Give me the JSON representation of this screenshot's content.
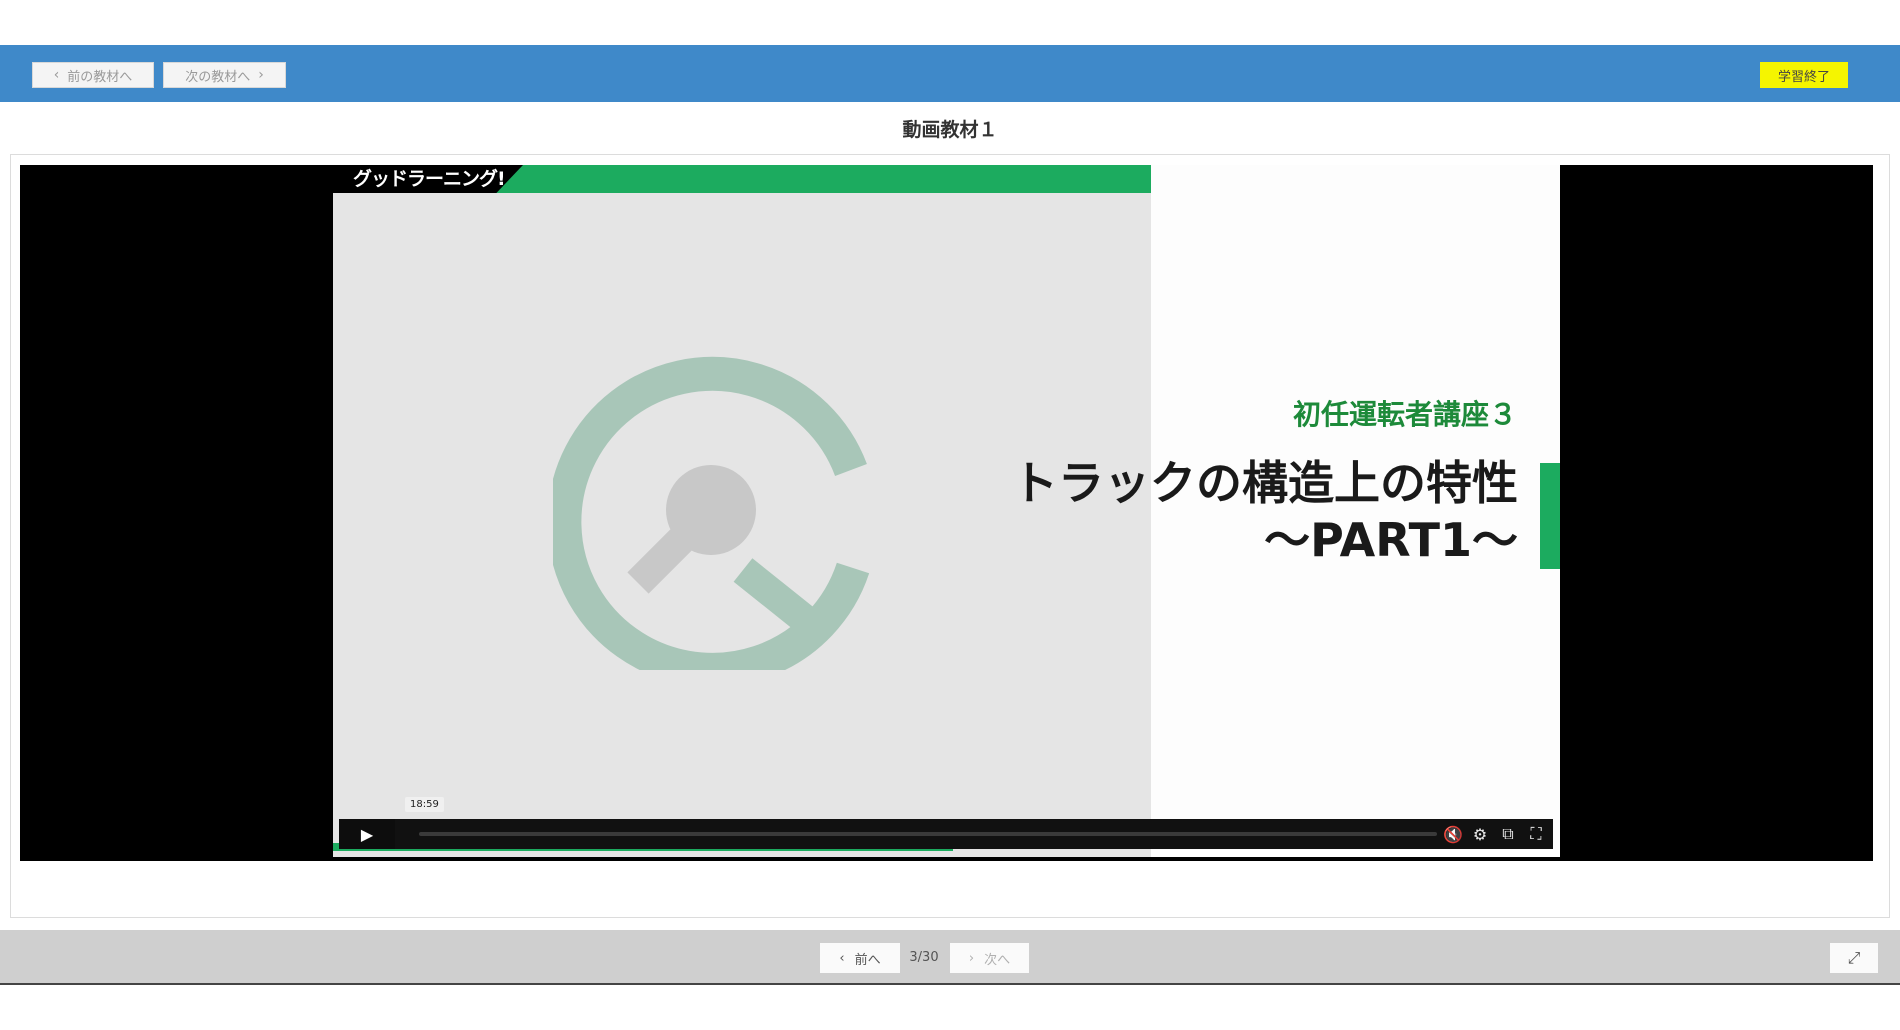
{
  "header": {
    "prev_material_label": "前の教材へ",
    "next_material_label": "次の教材へ",
    "finish_label": "学習終了"
  },
  "material_title": "動画教材１",
  "video": {
    "brand_name": "グッドラーニング!",
    "course_label": "初任運転者講座３",
    "title_line1": "トラックの構造上の特性",
    "title_line2": "～PART1～",
    "time_tooltip": "18:59",
    "progress_fraction": 0.0
  },
  "player_icons": [
    "volume-muted-icon",
    "settings-gear-icon",
    "picture-in-picture-icon",
    "fullscreen-icon"
  ],
  "pager": {
    "prev_label": "前へ",
    "next_label": "次へ",
    "page_counter": "3/30"
  },
  "colors": {
    "header_bg": "#3f89c9",
    "finish_button_bg": "#f5f500",
    "brand_green": "#1cab5f",
    "course_label_green": "#1d8a3a",
    "logo_color": "#a8c6b8"
  }
}
